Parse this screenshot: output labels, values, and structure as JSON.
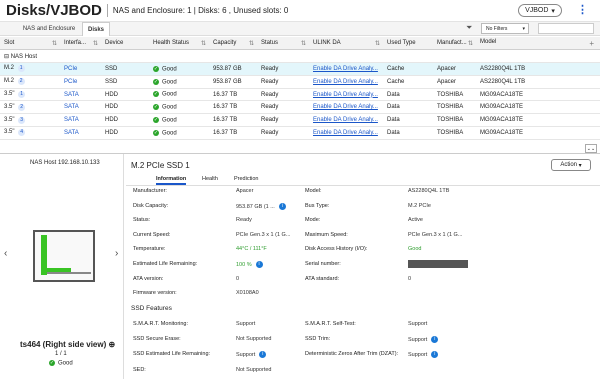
{
  "header": {
    "title": "Disks/VJBOD",
    "subtitle": "NAS and Enclosure: 1 | Disks: 6 , Unused slots: 0",
    "enclosure_select": "VJBOD"
  },
  "tabs": [
    {
      "label": "NAS and Enclosure"
    },
    {
      "label": "Disks"
    }
  ],
  "toolbar": {
    "filter_label": "No Filters"
  },
  "table": {
    "headers": [
      "Slot",
      "Interfa...",
      "Device",
      "Health Status",
      "Capacity",
      "Status",
      "ULINK DA",
      "Used Type",
      "Manufact...",
      "Model"
    ],
    "group": "NAS Host",
    "rows": [
      {
        "slot": "M.2",
        "num": "1",
        "iface": "PCIe",
        "device": "SSD",
        "health": "Good",
        "capacity": "953.87 GB",
        "status": "Ready",
        "ulink": "Enable DA Drive Analy...",
        "used": "Cache",
        "manu": "Apacer",
        "model": "AS2280Q4L 1TB"
      },
      {
        "slot": "M.2",
        "num": "2",
        "iface": "PCIe",
        "device": "SSD",
        "health": "Good",
        "capacity": "953.87 GB",
        "status": "Ready",
        "ulink": "Enable DA Drive Analy...",
        "used": "Cache",
        "manu": "Apacer",
        "model": "AS2280Q4L 1TB"
      },
      {
        "slot": "3.5\"",
        "num": "1",
        "iface": "SATA",
        "device": "HDD",
        "health": "Good",
        "capacity": "16.37 TB",
        "status": "Ready",
        "ulink": "Enable DA Drive Analy...",
        "used": "Data",
        "manu": "TOSHIBA",
        "model": "MG09ACA18TE"
      },
      {
        "slot": "3.5\"",
        "num": "2",
        "iface": "SATA",
        "device": "HDD",
        "health": "Good",
        "capacity": "16.37 TB",
        "status": "Ready",
        "ulink": "Enable DA Drive Analy...",
        "used": "Data",
        "manu": "TOSHIBA",
        "model": "MG09ACA18TE"
      },
      {
        "slot": "3.5\"",
        "num": "3",
        "iface": "SATA",
        "device": "HDD",
        "health": "Good",
        "capacity": "16.37 TB",
        "status": "Ready",
        "ulink": "Enable DA Drive Analy...",
        "used": "Data",
        "manu": "TOSHIBA",
        "model": "MG09ACA18TE"
      },
      {
        "slot": "3.5\"",
        "num": "4",
        "iface": "SATA",
        "device": "HDD",
        "health": "Good",
        "capacity": "16.37 TB",
        "status": "Ready",
        "ulink": "Enable DA Drive Analy...",
        "used": "Data",
        "manu": "TOSHIBA",
        "model": "MG09ACA18TE"
      }
    ]
  },
  "left": {
    "nas_label": "NAS Host 192.168.10.133",
    "model": "ts464 (Right side view)",
    "page": "1 / 1",
    "health": "Good"
  },
  "detail": {
    "title": "M.2 PCIe SSD 1",
    "action": "Action",
    "tabs": [
      "Information",
      "Health",
      "Prediction"
    ],
    "left": [
      {
        "label": "Manufacturer:",
        "value": "Apacer"
      },
      {
        "label": "Disk Capacity:",
        "value": "953.87 GB (1 ..."
      },
      {
        "label": "Status:",
        "value": "Ready"
      },
      {
        "label": "Current Speed:",
        "value": "PCIe Gen.3 x 1 (1 G..."
      },
      {
        "label": "Temperature:",
        "value": "44°C / 111°F"
      },
      {
        "label": "Estimated Life Remaining:",
        "value": "100 %"
      },
      {
        "label": "ATA version:",
        "value": "0"
      },
      {
        "label": "Firmware version:",
        "value": "X0108A0"
      }
    ],
    "right": [
      {
        "label": "Model:",
        "value": "AS2280Q4L 1TB"
      },
      {
        "label": "Bus Type:",
        "value": "M.2 PCIe"
      },
      {
        "label": "Mode:",
        "value": "Active"
      },
      {
        "label": "Maximum Speed:",
        "value": "PCIe Gen.3 x 1 (1 G..."
      },
      {
        "label": "Disk Access History (I/O):",
        "value": "Good"
      },
      {
        "label": "Serial number:",
        "value": ""
      },
      {
        "label": "ATA standard:",
        "value": "0"
      }
    ],
    "ssd_title": "SSD Features",
    "ssd_left": [
      {
        "label": "S.M.A.R.T. Monitoring:",
        "value": "Support"
      },
      {
        "label": "SSD Secure Erase:",
        "value": "Not Supported"
      },
      {
        "label": "SSD Estimated Life Remaining:",
        "value": "Support"
      },
      {
        "label": "SED:",
        "value": "Not Supported"
      }
    ],
    "ssd_right": [
      {
        "label": "S.M.A.R.T. Self-Test:",
        "value": "Support"
      },
      {
        "label": "SSD Trim:",
        "value": "Support"
      },
      {
        "label": "Deterministic Zeros After Trim (DZAT):",
        "value": "Support"
      }
    ]
  }
}
